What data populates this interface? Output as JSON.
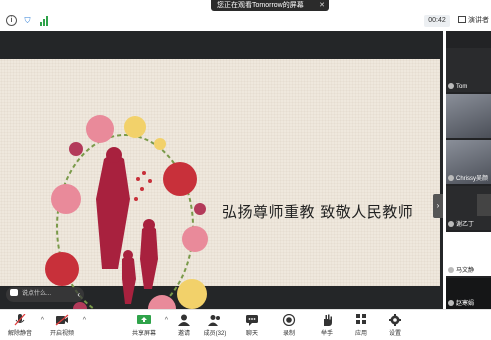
{
  "banner": {
    "text": "您正在观看Tomorrow的屏幕",
    "close": "✕"
  },
  "topbar": {
    "timer": "00:42",
    "speaker_label": "演讲者"
  },
  "slide": {
    "title": "弘扬尊师重教 致敬人民教师"
  },
  "chat": {
    "placeholder": "说点什么...",
    "chevron": "‹"
  },
  "collapse_handle": "›",
  "participants": [
    {
      "name": "Tom"
    },
    {
      "name": ""
    },
    {
      "name": "Chrissy吴颜"
    },
    {
      "name": "谢乙丁"
    },
    {
      "name": "马文静"
    },
    {
      "name": "赵寒娟"
    }
  ],
  "toolbar": {
    "mute": "解除静音",
    "video": "开启视频",
    "share": "共享屏幕",
    "invite": "邀请",
    "members": "成员(32)",
    "chat": "聊天",
    "record": "录制",
    "raise_hand": "举手",
    "apps": "应用",
    "settings": "设置"
  },
  "colors": {
    "stage_bg": "#242628",
    "slide_bg": "#efe8dd",
    "accent_blue": "#2a7bd5",
    "signal_green": "#2fa34a",
    "muted_red": "#e03b3b",
    "share_green": "#2fa34a"
  }
}
